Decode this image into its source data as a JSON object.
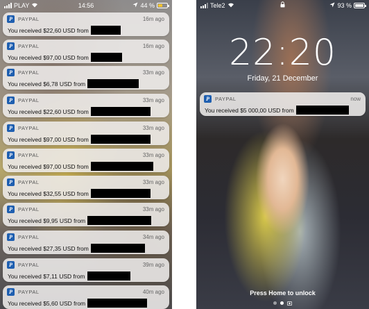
{
  "left_phone": {
    "statusbar": {
      "carrier": "PLAY",
      "time": "14:56",
      "battery": "44 %"
    },
    "notifications": [
      {
        "app": "PAYPAL",
        "time": "16m ago",
        "text": "You received $22,60 USD from"
      },
      {
        "app": "PAYPAL",
        "time": "16m ago",
        "text": "You received $97,00 USD from"
      },
      {
        "app": "PAYPAL",
        "time": "33m ago",
        "text": "You received $6,78 USD from"
      },
      {
        "app": "PAYPAL",
        "time": "33m ago",
        "text": "You received $22,60 USD from"
      },
      {
        "app": "PAYPAL",
        "time": "33m ago",
        "text": "You received $97,00 USD from"
      },
      {
        "app": "PAYPAL",
        "time": "33m ago",
        "text": "You received $97,00 USD from"
      },
      {
        "app": "PAYPAL",
        "time": "33m ago",
        "text": "You received $32,55 USD from"
      },
      {
        "app": "PAYPAL",
        "time": "33m ago",
        "text": "You received $9,95 USD from"
      },
      {
        "app": "PAYPAL",
        "time": "34m ago",
        "text": "You received $27,35 USD from"
      },
      {
        "app": "PAYPAL",
        "time": "39m ago",
        "text": "You received $7,11 USD from"
      },
      {
        "app": "PAYPAL",
        "time": "40m ago",
        "text": "You received $5,60 USD from"
      }
    ]
  },
  "right_phone": {
    "statusbar": {
      "carrier": "Tele2",
      "battery": "93 %"
    },
    "clock": "22:20",
    "date": "Friday, 21 December",
    "notification": {
      "app": "PAYPAL",
      "time": "now",
      "text": "You received $5 000,00 USD from"
    },
    "unlock_hint": "Press Home to unlock"
  },
  "icons": {
    "app": "paypal-icon",
    "wifi": "wifi-icon",
    "location": "location-arrow-icon",
    "lock": "lock-icon",
    "battery": "battery-icon",
    "camera": "camera-icon"
  },
  "colors": {
    "paypal_blue": "#1f5fb0",
    "battery_low": "#f4c430",
    "redaction": "#000000"
  }
}
